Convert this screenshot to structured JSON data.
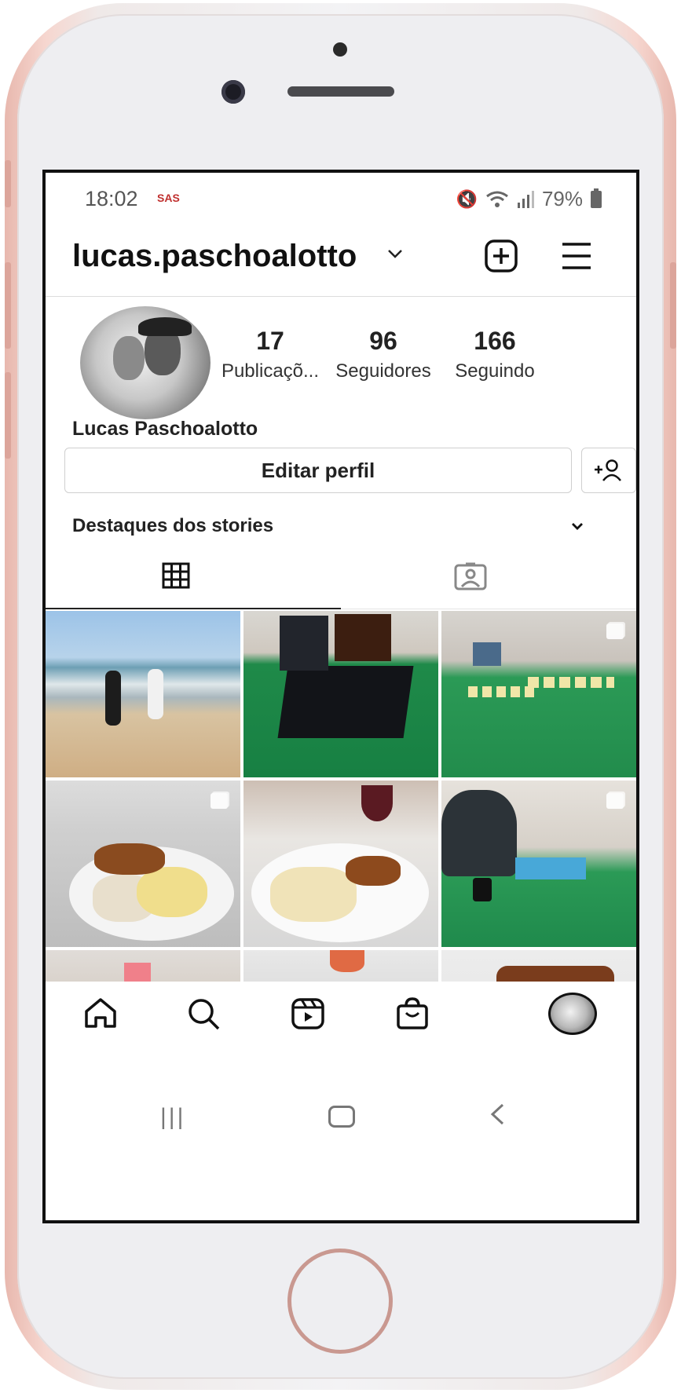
{
  "status_bar": {
    "time": "18:02",
    "app_badge": "SAS",
    "battery": "79%"
  },
  "header": {
    "username": "lucas.paschoalotto"
  },
  "profile": {
    "posts_count": "17",
    "posts_label": "Publicaçõ...",
    "followers_count": "96",
    "followers_label": "Seguidores",
    "following_count": "166",
    "following_label": "Seguindo",
    "full_name": "Lucas Paschoalotto",
    "bio": ".",
    "edit_profile_label": "Editar perfil",
    "highlights_label": "Destaques dos stories"
  },
  "tabs": [
    {
      "icon": "grid-icon",
      "active": true
    },
    {
      "icon": "tagged-icon",
      "active": false
    }
  ],
  "grid": {
    "rows": 3,
    "columns": 3,
    "cells": [
      {
        "subject": "beach photo",
        "multi": false
      },
      {
        "subject": "Cosmos board game",
        "multi": false
      },
      {
        "subject": "card game on table",
        "multi": true
      },
      {
        "subject": "plate with rice, puree and meat",
        "multi": true
      },
      {
        "subject": "pasta with breaded meat and wine",
        "multi": false
      },
      {
        "subject": "person playing board game",
        "multi": true
      },
      {
        "subject": "dinner table",
        "multi": false
      },
      {
        "subject": "pizza",
        "multi": false
      },
      {
        "subject": "lasagna slice",
        "multi": false
      }
    ]
  },
  "bottom_nav": [
    "home-icon",
    "search-icon",
    "reels-icon",
    "shop-icon",
    "profile-avatar"
  ],
  "colors": {
    "phone_frame": "#f6d6cf",
    "accent_text": "#222222",
    "divider": "#dcdcdc"
  }
}
